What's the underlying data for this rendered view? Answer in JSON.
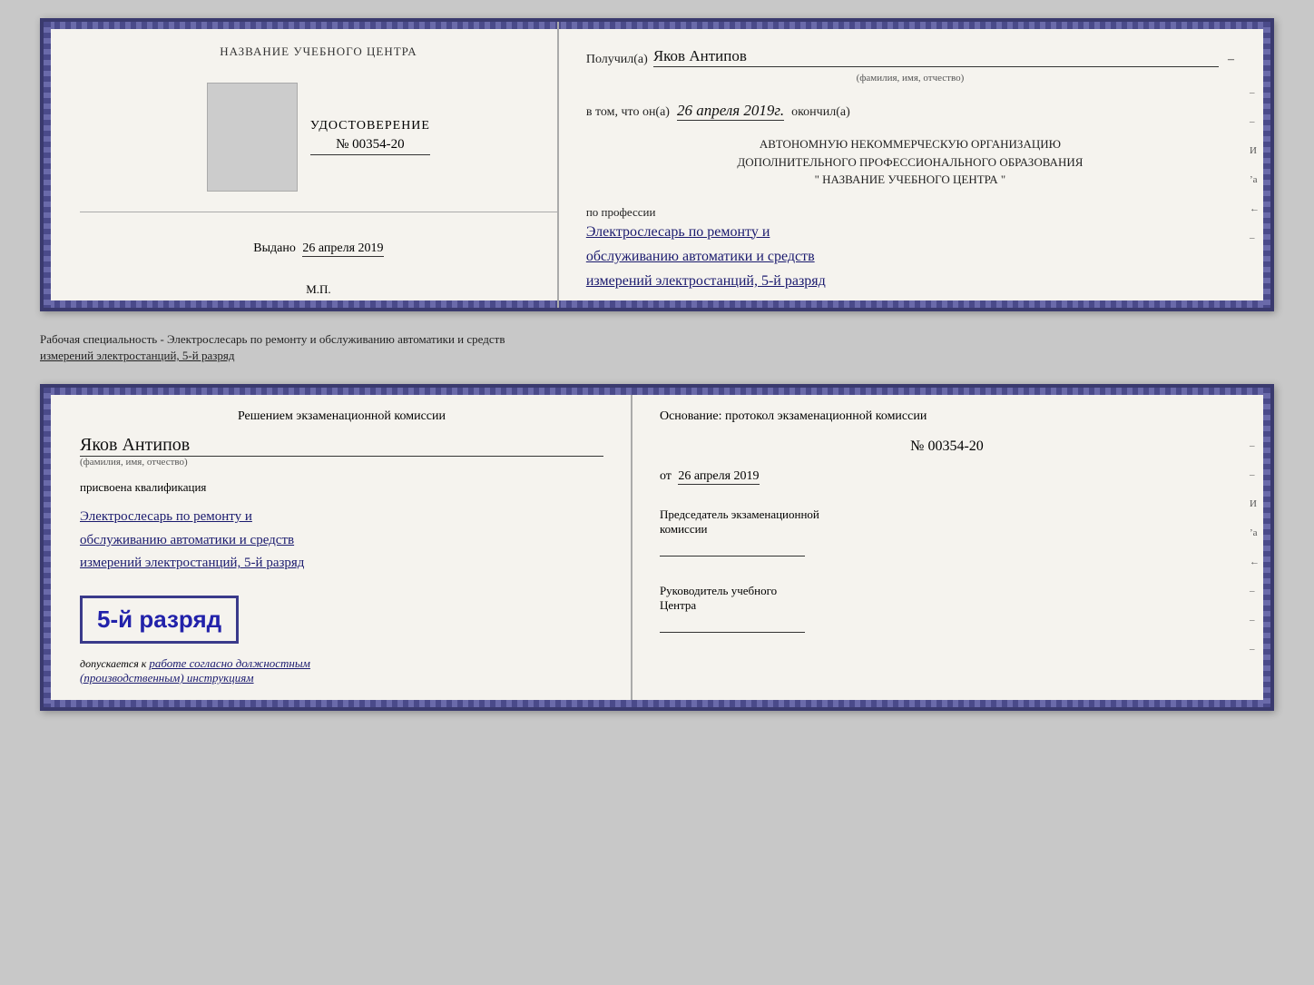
{
  "topCert": {
    "leftSide": {
      "orgTitle": "НАЗВАНИЕ УЧЕБНОГО ЦЕНТРА",
      "docLabel": "УДОСТОВЕРЕНИЕ",
      "docNumber": "№ 00354-20",
      "issuedLabel": "Выдано",
      "issuedDate": "26 апреля 2019",
      "stampLabel": "М.П."
    },
    "rightSide": {
      "receivedLabel": "Получил(а)",
      "recipientName": "Яков Антипов",
      "fioSubLabel": "(фамилия, имя, отчество)",
      "confirmText": "в том, что он(а)",
      "completionDate": "26 апреля 2019г.",
      "completedLabel": "окончил(а)",
      "orgLine1": "АВТОНОМНУЮ НЕКОММЕРЧЕСКУЮ ОРГАНИЗАЦИЮ",
      "orgLine2": "ДОПОЛНИТЕЛЬНОГО ПРОФЕССИОНАЛЬНОГО ОБРАЗОВАНИЯ",
      "orgLine3": "\"  НАЗВАНИЕ УЧЕБНОГО ЦЕНТРА  \"",
      "professionLabel": "по профессии",
      "professionLine1": "Электрослесарь по ремонту и",
      "professionLine2": "обслуживанию автоматики и средств",
      "professionLine3": "измерений электростанций, 5-й разряд"
    },
    "sideMark": "И а ←"
  },
  "betweenLabel": {
    "line1": "Рабочая специальность - Электрослесарь по ремонту и обслуживанию автоматики и средств",
    "line2": "измерений электростанций, 5-й разряд"
  },
  "bottomCert": {
    "leftSide": {
      "commissionTitle": "Решением экзаменационной комиссии",
      "recipientName": "Яков Антипов",
      "fioSubLabel": "(фамилия, имя, отчество)",
      "assignedLabel": "присвоена квалификация",
      "qualLine1": "Электрослесарь по ремонту и",
      "qualLine2": "обслуживанию автоматики и средств",
      "qualLine3": "измерений электростанций, 5-й разряд",
      "rankBadge": "5-й разряд",
      "admissionText1": "допускается к",
      "admissionText2": "работе согласно должностным",
      "admissionText3": "(производственным) инструкциям"
    },
    "rightSide": {
      "basisLabel": "Основание: протокол экзаменационной комиссии",
      "protocolNumber": "№  00354-20",
      "protocolDatePrefix": "от",
      "protocolDate": "26 апреля 2019",
      "chairmanTitle": "Председатель экзаменационной",
      "chairmanTitle2": "комиссии",
      "headTitle": "Руководитель учебного",
      "headTitle2": "Центра"
    },
    "sideMark": "И а ←"
  }
}
